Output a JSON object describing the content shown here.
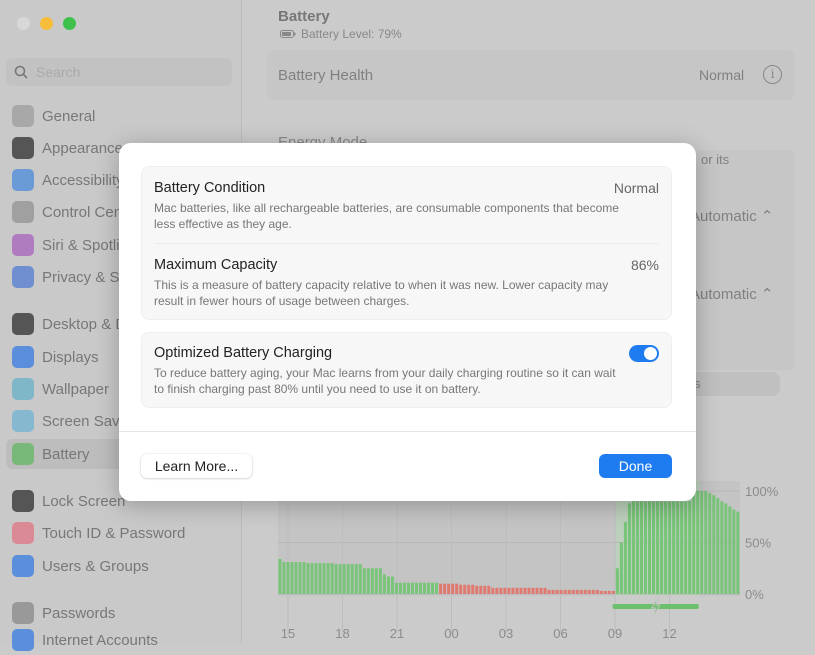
{
  "sidebar": {
    "search_placeholder": "Search",
    "items": [
      {
        "label": "General",
        "icon": "gear-icon",
        "color": "#a8a8a8"
      },
      {
        "label": "Appearance",
        "icon": "appearance-icon",
        "color": "#555555"
      },
      {
        "label": "Accessibility",
        "icon": "accessibility-icon",
        "color": "#6a9bd6"
      },
      {
        "label": "Control Centre",
        "icon": "control-centre-icon",
        "color": "#a0a0a0"
      },
      {
        "label": "Siri & Spotlight",
        "icon": "siri-icon",
        "color": "#b07cc0"
      },
      {
        "label": "Privacy & Security",
        "icon": "hand-icon",
        "color": "#6f8fd0"
      },
      {
        "label": "Desktop & Dock",
        "icon": "dock-icon",
        "color": "#555555"
      },
      {
        "label": "Displays",
        "icon": "sun-icon",
        "color": "#5b8fdc"
      },
      {
        "label": "Wallpaper",
        "icon": "flower-icon",
        "color": "#7fb6c8"
      },
      {
        "label": "Screen Saver",
        "icon": "screensaver-icon",
        "color": "#86b9cf"
      },
      {
        "label": "Battery",
        "icon": "battery-icon",
        "color": "#78b878",
        "selected": true
      },
      {
        "label": "Lock Screen",
        "icon": "lock-icon",
        "color": "#555555"
      },
      {
        "label": "Touch ID & Password",
        "icon": "fingerprint-icon",
        "color": "#d98a95"
      },
      {
        "label": "Users & Groups",
        "icon": "users-icon",
        "color": "#5b8fdc"
      },
      {
        "label": "Passwords",
        "icon": "key-icon",
        "color": "#999999"
      },
      {
        "label": "Internet Accounts",
        "icon": "at-icon",
        "color": "#5b8fdc"
      }
    ]
  },
  "main": {
    "title": "Battery",
    "battery_level": "Battery Level: 79%",
    "health_label": "Battery Health",
    "health_value": "Normal",
    "energy_mode_label": "Energy Mode",
    "partial_text": "or its",
    "energy_option_1": "Automatic",
    "energy_option_2": "Automatic",
    "partial_tab": "s"
  },
  "chart_data": {
    "type": "bar",
    "x_tick_labels": [
      "15",
      "18",
      "21",
      "00",
      "03",
      "06",
      "09",
      "12"
    ],
    "y_tick_labels": [
      "100%",
      "50%",
      "0%"
    ],
    "ylim": [
      0,
      100
    ],
    "grid": true,
    "colors": {
      "normal": "#78c478",
      "low": "#e07a70",
      "charging_indicator": "#6cc06c"
    },
    "charging_range_bars": [
      84,
      105
    ],
    "values": [
      34,
      31,
      31,
      31,
      31,
      31,
      31,
      30,
      30,
      30,
      30,
      30,
      30,
      30,
      29,
      29,
      29,
      29,
      29,
      29,
      29,
      25,
      25,
      25,
      25,
      25,
      19,
      17,
      17,
      11,
      11,
      11,
      11,
      11,
      11,
      11,
      11,
      11,
      11,
      11,
      10,
      10,
      10,
      10,
      10,
      9,
      9,
      9,
      9,
      8,
      8,
      8,
      8,
      6,
      6,
      6,
      6,
      6,
      6,
      6,
      6,
      6,
      6,
      6,
      6,
      6,
      6,
      4,
      4,
      4,
      4,
      4,
      4,
      4,
      4,
      4,
      4,
      4,
      4,
      4,
      3,
      3,
      3,
      3,
      25,
      50,
      70,
      88,
      90,
      90,
      90,
      90,
      90,
      90,
      90,
      90,
      90,
      90,
      90,
      90,
      90,
      90,
      90,
      100,
      100,
      100,
      100,
      98,
      96,
      93,
      90,
      88,
      85,
      82,
      80
    ],
    "low_range_bars": [
      40,
      83
    ]
  },
  "dialog": {
    "condition_title": "Battery Condition",
    "condition_value": "Normal",
    "condition_desc": "Mac batteries, like all rechargeable batteries, are consumable components that become less effective as they age.",
    "capacity_title": "Maximum Capacity",
    "capacity_value": "86%",
    "capacity_desc": "This is a measure of battery capacity relative to when it was new. Lower capacity may result in fewer hours of usage between charges.",
    "optimized_title": "Optimized Battery Charging",
    "optimized_desc": "To reduce battery aging, your Mac learns from your daily charging routine so it can wait to finish charging past 80% until you need to use it on battery.",
    "optimized_enabled": true,
    "learn_more": "Learn More...",
    "done": "Done",
    "accent": "#1f7cf0"
  }
}
